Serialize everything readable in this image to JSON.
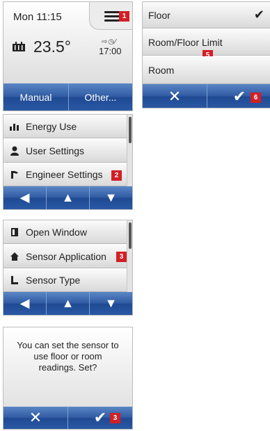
{
  "home": {
    "time": "Mon 11:15",
    "temperature": "23.5°",
    "schedule_time": "17:00",
    "schedule_icons": "⇨◷⁄",
    "buttons": {
      "manual": "Manual",
      "other": "Other..."
    },
    "badge": "1"
  },
  "sensor_select": {
    "options": [
      {
        "label": "Floor",
        "selected": true
      },
      {
        "label": "Room/Floor Limit",
        "selected": false
      },
      {
        "label": "Room",
        "selected": false
      }
    ],
    "badge_options": "5",
    "cancel_symbol": "✕",
    "confirm_symbol": "✔",
    "badge_confirm": "6"
  },
  "main_menu": {
    "items": [
      {
        "label": "Energy Use",
        "icon": "bar-chart-icon"
      },
      {
        "label": "User Settings",
        "icon": "user-icon"
      },
      {
        "label": "Engineer Settings",
        "icon": "wrench-icon"
      }
    ],
    "badge": "2",
    "nav": {
      "left": "◀",
      "up": "▲",
      "down": "▼"
    }
  },
  "engineer_menu": {
    "items": [
      {
        "label": "Open Window",
        "icon": "window-icon"
      },
      {
        "label": "Sensor Application",
        "icon": "house-icon"
      },
      {
        "label": "Sensor Type",
        "icon": "sensor-icon"
      }
    ],
    "badge": "3",
    "nav": {
      "left": "◀",
      "up": "▲",
      "down": "▼"
    }
  },
  "confirm_dialog": {
    "message": "You can set the sensor to use floor or room readings. Set?",
    "cancel_symbol": "✕",
    "confirm_symbol": "✔",
    "badge": "3"
  },
  "colors": {
    "accent_blue": "#2f5aa2",
    "badge_red": "#d21f26"
  }
}
